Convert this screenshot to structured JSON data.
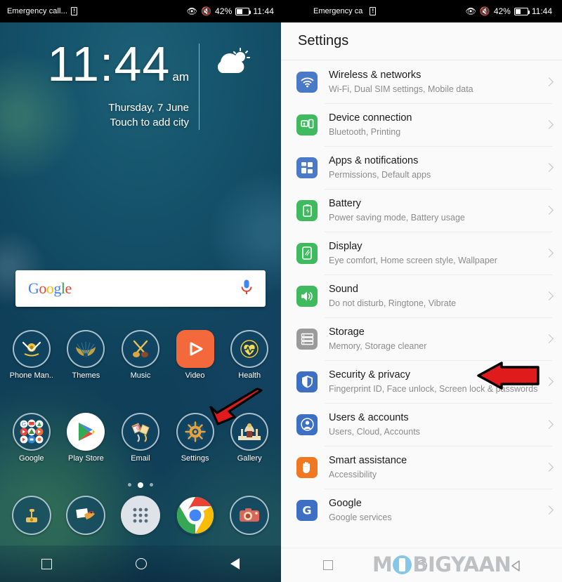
{
  "home": {
    "statusbar": {
      "carrier": "Emergency call...",
      "sim_icon": "sim-card-alert-icon",
      "eye_icon": "eye-comfort-icon",
      "mute_icon": "mute-icon",
      "battery_percent": "42%",
      "time": "11:44"
    },
    "clock_widget": {
      "time": "11:44",
      "ampm": "am",
      "date": "Thursday, 7 June",
      "city_hint": "Touch to add city",
      "weather_icon": "partly-cloudy-icon"
    },
    "search": {
      "logo_letters": [
        {
          "char": "G",
          "color": "#4285f4"
        },
        {
          "char": "o",
          "color": "#ea4335"
        },
        {
          "char": "o",
          "color": "#fbbc05"
        },
        {
          "char": "g",
          "color": "#4285f4"
        },
        {
          "char": "l",
          "color": "#34a853"
        },
        {
          "char": "e",
          "color": "#ea4335"
        }
      ],
      "mic_icon": "microphone-icon"
    },
    "apps_row1": [
      {
        "label": "Phone Man..",
        "icon": "phone-manager-icon"
      },
      {
        "label": "Themes",
        "icon": "themes-icon"
      },
      {
        "label": "Music",
        "icon": "music-icon"
      },
      {
        "label": "Video",
        "icon": "video-icon"
      },
      {
        "label": "Health",
        "icon": "health-icon"
      }
    ],
    "apps_row2": [
      {
        "label": "Google",
        "icon": "google-folder-icon"
      },
      {
        "label": "Play Store",
        "icon": "play-store-icon"
      },
      {
        "label": "Email",
        "icon": "email-icon"
      },
      {
        "label": "Settings",
        "icon": "settings-icon"
      },
      {
        "label": "Gallery",
        "icon": "gallery-icon"
      }
    ],
    "dock": [
      {
        "label": "Phone",
        "icon": "dialer-icon"
      },
      {
        "label": "Messages",
        "icon": "messages-icon"
      },
      {
        "label": "App drawer",
        "icon": "app-drawer-icon"
      },
      {
        "label": "Chrome",
        "icon": "chrome-icon"
      },
      {
        "label": "Camera",
        "icon": "camera-icon"
      }
    ],
    "page_dots": {
      "count": 3,
      "active_index": 1
    },
    "navbar": [
      {
        "icon": "recents-square-icon"
      },
      {
        "icon": "home-circle-icon"
      },
      {
        "icon": "back-triangle-icon"
      }
    ],
    "annotation_arrow": {
      "icon": "red-arrow-icon",
      "points_to": "Settings",
      "color": "#e01b1b"
    }
  },
  "settings": {
    "statusbar": {
      "carrier": "Emergency ca",
      "sim_icon": "sim-card-alert-icon",
      "eye_icon": "eye-comfort-icon",
      "mute_icon": "mute-icon",
      "battery_percent": "42%",
      "time": "11:44"
    },
    "header": {
      "title": "Settings"
    },
    "items": [
      {
        "title": "Wireless & networks",
        "subtitle": "Wi-Fi, Dual SIM settings, Mobile data",
        "icon": "wifi-icon",
        "color": "#4a7ac7"
      },
      {
        "title": "Device connection",
        "subtitle": "Bluetooth, Printing",
        "icon": "device-connection-icon",
        "color": "#3fba5e"
      },
      {
        "title": "Apps & notifications",
        "subtitle": "Permissions, Default apps",
        "icon": "apps-grid-icon",
        "color": "#4a7ac7"
      },
      {
        "title": "Battery",
        "subtitle": "Power saving mode, Battery usage",
        "icon": "battery-icon",
        "color": "#3fba5e"
      },
      {
        "title": "Display",
        "subtitle": "Eye comfort, Home screen style, Wallpaper",
        "icon": "display-icon",
        "color": "#3fba5e"
      },
      {
        "title": "Sound",
        "subtitle": "Do not disturb, Ringtone, Vibrate",
        "icon": "sound-icon",
        "color": "#3fba5e"
      },
      {
        "title": "Storage",
        "subtitle": "Memory, Storage cleaner",
        "icon": "storage-icon",
        "color": "#9a9a9a"
      },
      {
        "title": "Security & privacy",
        "subtitle": "Fingerprint ID, Face unlock, Screen lock & passwords",
        "icon": "shield-icon",
        "color": "#3d6fc4"
      },
      {
        "title": "Users & accounts",
        "subtitle": "Users, Cloud, Accounts",
        "icon": "user-account-icon",
        "color": "#3d6fc4"
      },
      {
        "title": "Smart assistance",
        "subtitle": "Accessibility",
        "icon": "hand-icon",
        "color": "#ef7820"
      },
      {
        "title": "Google",
        "subtitle": "Google services",
        "icon": "google-g-icon",
        "color": "#3d6fc4"
      }
    ],
    "navbar": [
      {
        "icon": "recents-square-icon"
      },
      {
        "icon": "home-circle-icon"
      },
      {
        "icon": "back-triangle-icon"
      }
    ],
    "annotation_arrow": {
      "icon": "red-arrow-icon",
      "points_to": "Security & privacy",
      "color": "#e01b1b"
    }
  },
  "watermark": {
    "text_before": "M",
    "text_after": "BIGYAAN",
    "full": "MOBIGYAAN",
    "color": "#b9bdc0",
    "accent": "#7cc3e8"
  }
}
